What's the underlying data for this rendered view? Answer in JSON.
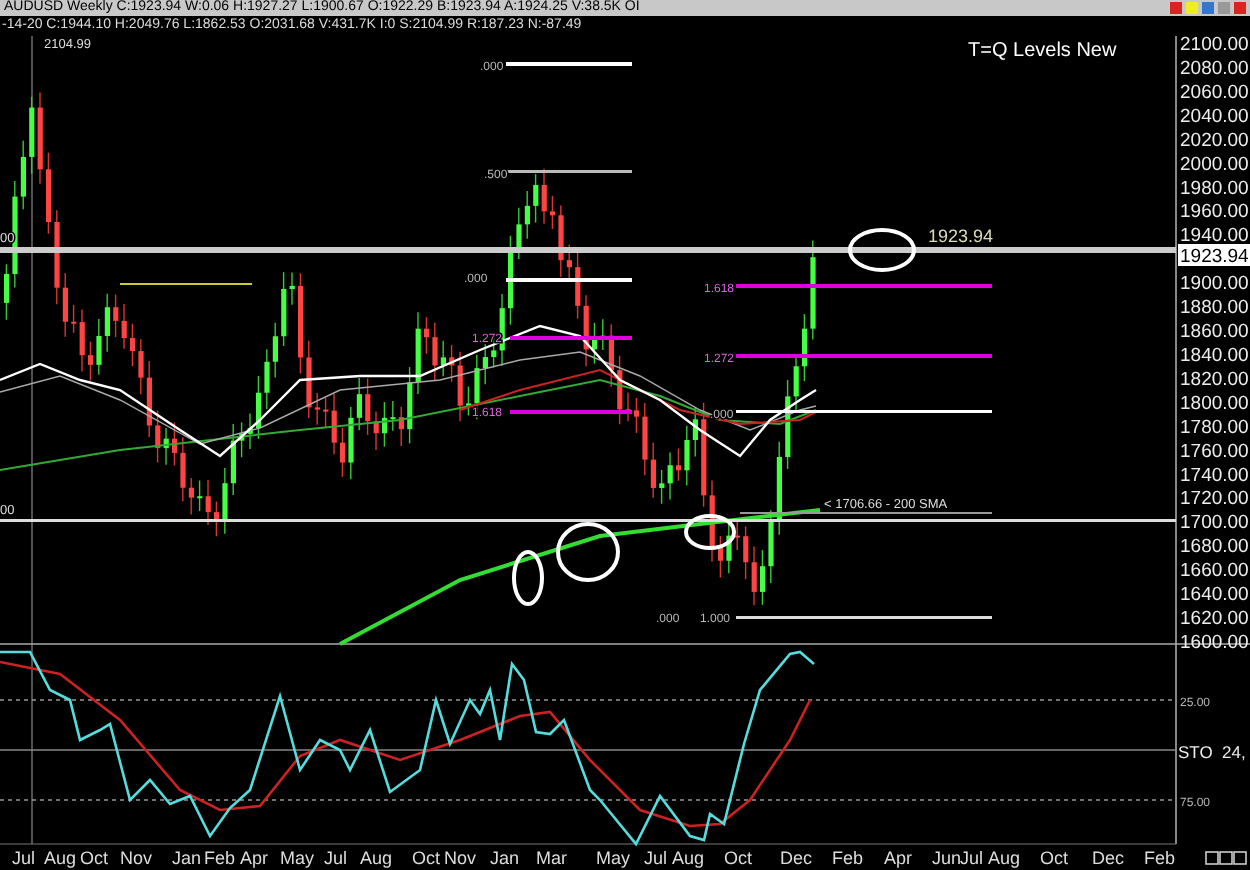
{
  "title_bar": {
    "text": "AUDUSD Weekly C:1923.94 W:0.06 H:1927.27 L:1900.67 O:1922.29 B:1923.94 A:1924.25 V:38.5K OI"
  },
  "header": {
    "text": "-14-20 C:1944.10 H:2049.76 L:1862.53 O:2031.68 V:431.7K I:0 S:2104.99 R:187.23 N:-87.49"
  },
  "price_axis": [
    "2100.00",
    "2080.00",
    "2060.00",
    "2040.00",
    "2020.00",
    "2000.00",
    "1980.00",
    "1960.00",
    "1940.00",
    "1900.00",
    "1880.00",
    "1860.00",
    "1840.00",
    "1820.00",
    "1800.00",
    "1780.00",
    "1760.00",
    "1740.00",
    "1720.00",
    "1700.00",
    "1680.00",
    "1660.00",
    "1640.00",
    "1620.00",
    "1600.00"
  ],
  "price_tag": "1923.94",
  "annotations": [
    {
      "text": "2104.99",
      "kind": "note"
    },
    {
      "text": "T=Q Levels New",
      "kind": "title"
    },
    {
      "text": ".000",
      "kind": "fib"
    },
    {
      "text": ".500",
      "kind": "fib"
    },
    {
      "text": "00",
      "kind": "note"
    },
    {
      "text": "1923.94",
      "kind": "level"
    },
    {
      "text": ".000",
      "kind": "fib"
    },
    {
      "text": "1.618",
      "kind": "ext"
    },
    {
      "text": "1.272",
      "kind": "ext"
    },
    {
      "text": "1.272",
      "kind": "ext"
    },
    {
      "text": "1.618",
      "kind": "ext"
    },
    {
      "text": ".000",
      "kind": "fib"
    },
    {
      "text": "< 1706.66 - 200 SMA",
      "kind": "note"
    },
    {
      "text": "00",
      "kind": "note"
    },
    {
      "text": ".000",
      "kind": "fib"
    },
    {
      "text": "1.000",
      "kind": "fib"
    }
  ],
  "stochastic": {
    "labels": [
      "25.00",
      "75.00"
    ],
    "name": "STO  24,"
  },
  "time_axis": [
    "Jul",
    "Aug",
    "Oct",
    "Nov",
    "Jan",
    "Feb",
    "Apr",
    "May",
    "Jul",
    "Aug",
    "Oct",
    "Nov",
    "Jan",
    "Mar",
    "May",
    "Jul",
    "Aug",
    "Oct",
    "Dec",
    "Feb",
    "Apr",
    "Jun",
    "Jul",
    "Aug",
    "Oct",
    "Dec",
    "Feb"
  ]
}
